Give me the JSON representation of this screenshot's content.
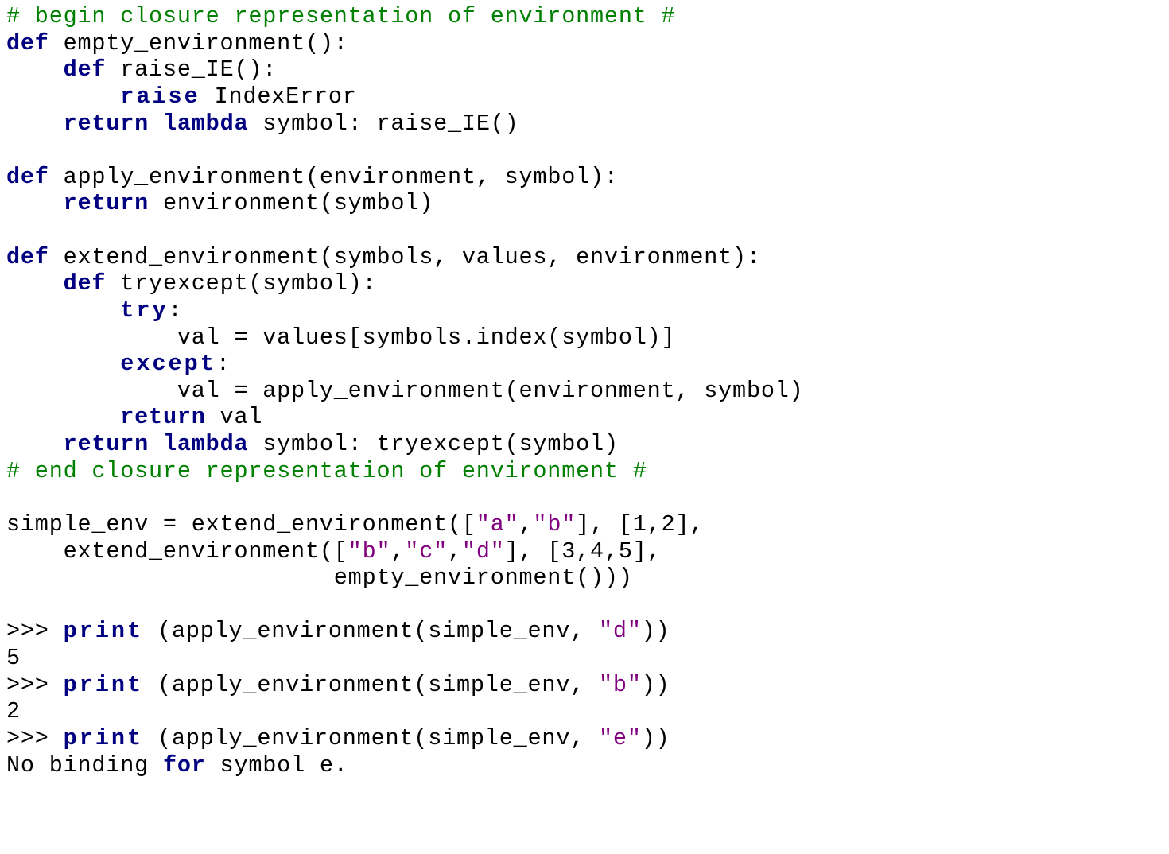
{
  "code": {
    "l01_comment": "# begin closure representation of environment #",
    "l02_def": "def",
    "l02_rest": " empty_environment():",
    "l03_def": "def",
    "l03_rest": " raise_IE():",
    "l04_raise": "raise",
    "l04_rest": " IndexError",
    "l05_return": "return",
    "l05_lambda": "lambda",
    "l05_rest": " symbol: raise_IE()",
    "l07_def": "def",
    "l07_rest": " apply_environment(environment, symbol):",
    "l08_return": "return",
    "l08_rest": " environment(symbol)",
    "l10_def": "def",
    "l10_rest": " extend_environment(symbols, values, environment):",
    "l11_def": "def",
    "l11_rest": " tryexcept(symbol):",
    "l12_try": "try",
    "l12_colon": ":",
    "l13": "            val = values[symbols.index(symbol)]",
    "l14_except": "except",
    "l14_colon": ":",
    "l15": "            val = apply_environment(environment, symbol)",
    "l16_return": "return",
    "l16_rest": " val",
    "l17_return": "return",
    "l17_lambda": "lambda",
    "l17_rest": " symbol: tryexcept(symbol)",
    "l18_comment": "# end closure representation of environment #",
    "l20_a": "simple_env = extend_environment([",
    "l20_s1": "\"a\"",
    "l20_comma1": ",",
    "l20_s2": "\"b\"",
    "l20_b": "], [1,2],",
    "l21_a": "    extend_environment([",
    "l21_s1": "\"b\"",
    "l21_c1": ",",
    "l21_s2": "\"c\"",
    "l21_c2": ",",
    "l21_s3": "\"d\"",
    "l21_b": "], [3,4,5],",
    "l22": "                       empty_environment()))",
    "l24_a": ">>> ",
    "l24_print": "print",
    "l24_b": " (apply_environment(simple_env, ",
    "l24_s": "\"d\"",
    "l24_c": "))",
    "l25": "5",
    "l26_a": ">>> ",
    "l26_print": "print",
    "l26_b": " (apply_environment(simple_env, ",
    "l26_s": "\"b\"",
    "l26_c": "))",
    "l27": "2",
    "l28_a": ">>> ",
    "l28_print": "print",
    "l28_b": " (apply_environment(simple_env, ",
    "l28_s": "\"e\"",
    "l28_c": "))",
    "l29_a": "No binding ",
    "l29_for": "for",
    "l29_b": " symbol e."
  }
}
